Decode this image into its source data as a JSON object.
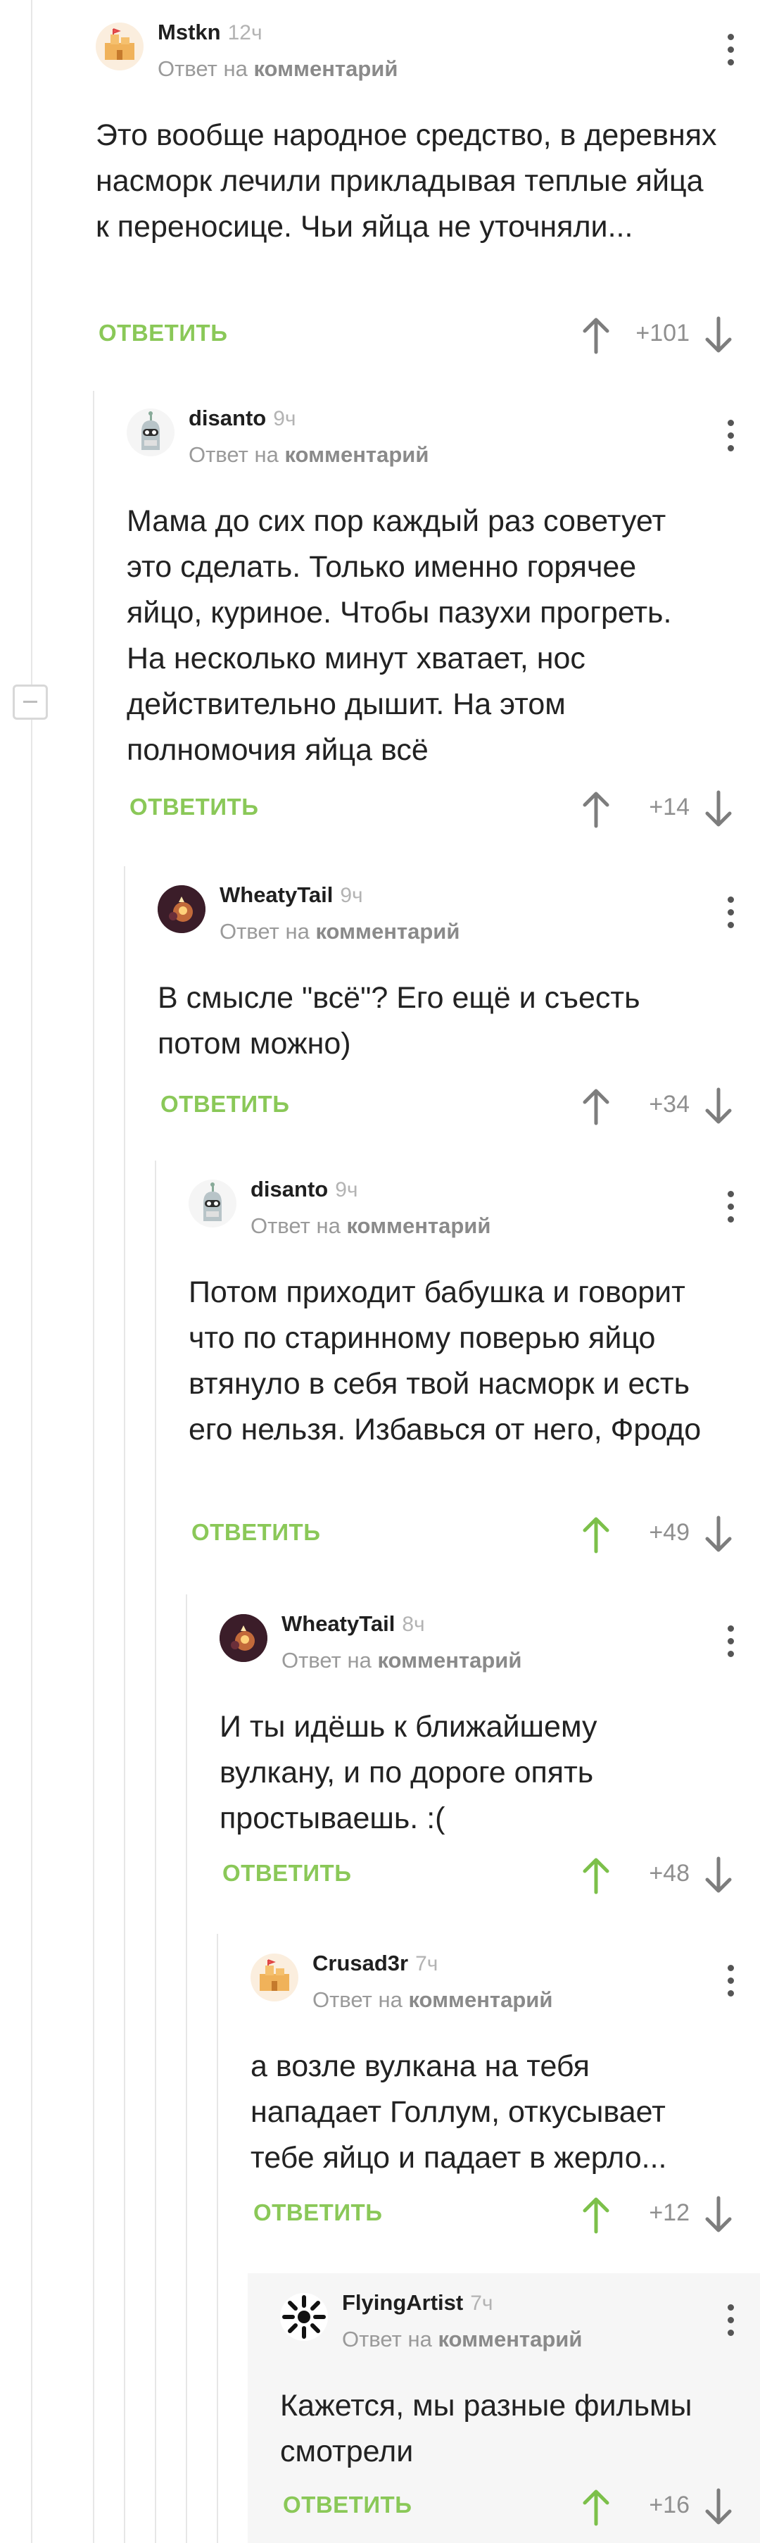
{
  "reply_prefix": "Ответ на",
  "reply_link": "комментарий",
  "reply_action": "ОТВЕТИТЬ",
  "colors": {
    "accent_green": "#8ac858",
    "vote_gray": "#7d7d7d",
    "upvoted": "#7cc04a"
  },
  "comments": [
    {
      "user": "Mstkn",
      "time": "12ч",
      "avatar_icon": "sand-castle-icon",
      "text": "Это вообще народное средство, в деревнях насморк лечили прикладывая теплые яйца к переносице. Чьи яйца не уточняли...",
      "score": "+101",
      "upvoted": false
    },
    {
      "user": "disanto",
      "time": "9ч",
      "avatar_icon": "robot-bender-icon",
      "text": "Мама до сих пор каждый раз советует это сделать. Только именно горячее яйцо, куриное. Чтобы пазухи прогреть. На несколько минут хватает, нос действительно дышит. На этом полномочия яйца всё",
      "score": "+14",
      "upvoted": false
    },
    {
      "user": "WheatyTail",
      "time": "9ч",
      "avatar_icon": "candle-cat-icon",
      "text": "В смысле \"всё\"? Его ещё и съесть потом можно)",
      "score": "+34",
      "upvoted": false
    },
    {
      "user": "disanto",
      "time": "9ч",
      "avatar_icon": "robot-bender-icon",
      "text": "Потом приходит бабушка и говорит что по старинному поверью яйцо втянуло в себя твой насморк и есть его нельзя. Избавься от него, Фродо",
      "score": "+49",
      "upvoted": true
    },
    {
      "user": "WheatyTail",
      "time": "8ч",
      "avatar_icon": "candle-cat-icon",
      "text": "И ты идёшь к ближайшему вулкану, и по дороге опять простываешь. :(",
      "score": "+48",
      "upvoted": true
    },
    {
      "user": "Crusad3r",
      "time": "7ч",
      "avatar_icon": "sand-castle-icon",
      "text": "а возле вулкана на тебя нападает Голлум, откусывает тебе яйцо и падает в жерло...",
      "score": "+12",
      "upvoted": true
    },
    {
      "user": "FlyingArtist",
      "time": "7ч",
      "avatar_icon": "hands-circle-icon",
      "text": "Кажется, мы разные фильмы смотрели",
      "score": "+16",
      "upvoted": true
    }
  ]
}
